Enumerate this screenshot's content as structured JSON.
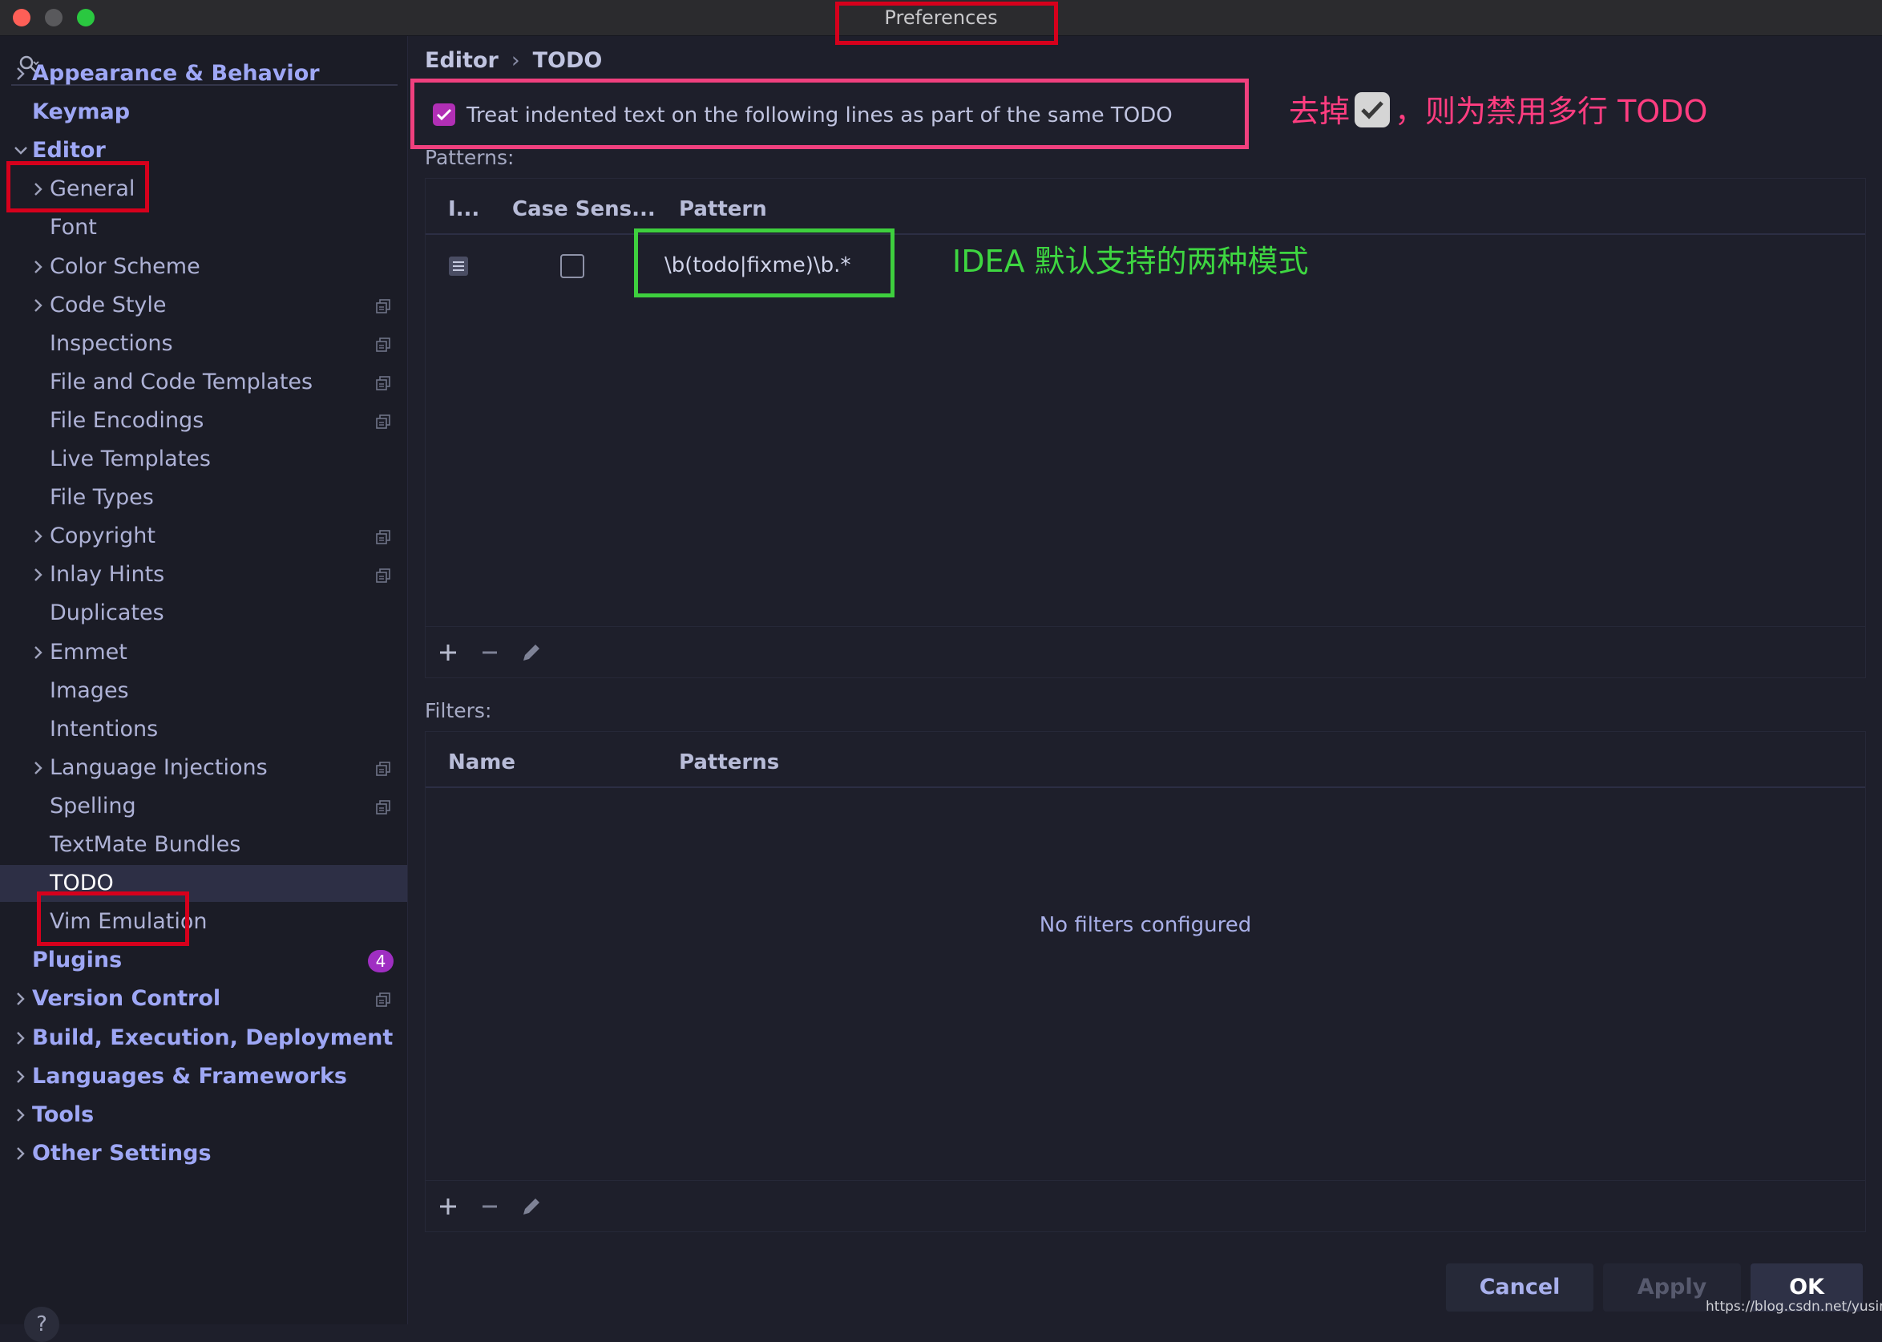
{
  "window": {
    "title": "Preferences"
  },
  "sidebar": {
    "items": [
      {
        "label": "Appearance & Behavior",
        "level": 0,
        "expandable": true,
        "expanded": false,
        "copy_icon": false
      },
      {
        "label": "Keymap",
        "level": 0,
        "expandable": false,
        "copy_icon": false
      },
      {
        "label": "Editor",
        "level": 0,
        "expandable": true,
        "expanded": true,
        "copy_icon": false
      },
      {
        "label": "General",
        "level": 1,
        "expandable": true,
        "copy_icon": false
      },
      {
        "label": "Font",
        "level": 1,
        "expandable": false,
        "copy_icon": false
      },
      {
        "label": "Color Scheme",
        "level": 1,
        "expandable": true,
        "copy_icon": false
      },
      {
        "label": "Code Style",
        "level": 1,
        "expandable": true,
        "copy_icon": true
      },
      {
        "label": "Inspections",
        "level": 1,
        "expandable": false,
        "copy_icon": true
      },
      {
        "label": "File and Code Templates",
        "level": 1,
        "expandable": false,
        "copy_icon": true
      },
      {
        "label": "File Encodings",
        "level": 1,
        "expandable": false,
        "copy_icon": true
      },
      {
        "label": "Live Templates",
        "level": 1,
        "expandable": false,
        "copy_icon": false
      },
      {
        "label": "File Types",
        "level": 1,
        "expandable": false,
        "copy_icon": false
      },
      {
        "label": "Copyright",
        "level": 1,
        "expandable": true,
        "copy_icon": true
      },
      {
        "label": "Inlay Hints",
        "level": 1,
        "expandable": true,
        "copy_icon": true
      },
      {
        "label": "Duplicates",
        "level": 1,
        "expandable": false,
        "copy_icon": false
      },
      {
        "label": "Emmet",
        "level": 1,
        "expandable": true,
        "copy_icon": false
      },
      {
        "label": "Images",
        "level": 1,
        "expandable": false,
        "copy_icon": false
      },
      {
        "label": "Intentions",
        "level": 1,
        "expandable": false,
        "copy_icon": false
      },
      {
        "label": "Language Injections",
        "level": 1,
        "expandable": true,
        "copy_icon": true
      },
      {
        "label": "Spelling",
        "level": 1,
        "expandable": false,
        "copy_icon": true
      },
      {
        "label": "TextMate Bundles",
        "level": 1,
        "expandable": false,
        "copy_icon": false
      },
      {
        "label": "TODO",
        "level": 1,
        "expandable": false,
        "copy_icon": false,
        "selected": true
      },
      {
        "label": "Vim Emulation",
        "level": 1,
        "expandable": false,
        "copy_icon": false
      },
      {
        "label": "Plugins",
        "level": 0,
        "expandable": false,
        "copy_icon": false,
        "badge": "4"
      },
      {
        "label": "Version Control",
        "level": 0,
        "expandable": true,
        "copy_icon": true
      },
      {
        "label": "Build, Execution, Deployment",
        "level": 0,
        "expandable": true,
        "copy_icon": false
      },
      {
        "label": "Languages & Frameworks",
        "level": 0,
        "expandable": true,
        "copy_icon": false
      },
      {
        "label": "Tools",
        "level": 0,
        "expandable": true,
        "copy_icon": false
      },
      {
        "label": "Other Settings",
        "level": 0,
        "expandable": true,
        "copy_icon": false
      }
    ],
    "help_label": "?"
  },
  "breadcrumb": {
    "parent": "Editor",
    "separator": "›",
    "current": "TODO"
  },
  "treat_indented": {
    "label": "Treat indented text on the following lines as part of the same TODO",
    "checked": true
  },
  "annotations": {
    "pink_before": "去掉",
    "pink_after": "，则为禁用多行 TODO",
    "green": "IDEA 默认支持的两种模式"
  },
  "patterns": {
    "section_label": "Patterns:",
    "columns": [
      "I...",
      "Case Sens...",
      "Pattern"
    ],
    "rows": [
      {
        "case_sensitive": false,
        "pattern": "\\b(todo|fixme)\\b.*"
      }
    ]
  },
  "filters": {
    "section_label": "Filters:",
    "columns": [
      "Name",
      "Patterns"
    ],
    "empty_text": "No filters configured"
  },
  "buttons": {
    "cancel": "Cancel",
    "apply": "Apply",
    "ok": "OK"
  },
  "watermark": "https://blog.csdn.net/yusimiao",
  "colors": {
    "background": "#1e1f2b",
    "sidebar_bg": "#1b1c26",
    "accent_check": "#b12fb5",
    "badge": "#9f2ec2",
    "annotation_red": "#d6001c",
    "annotation_pink": "#f0407e",
    "annotation_green": "#3ecf3e"
  }
}
